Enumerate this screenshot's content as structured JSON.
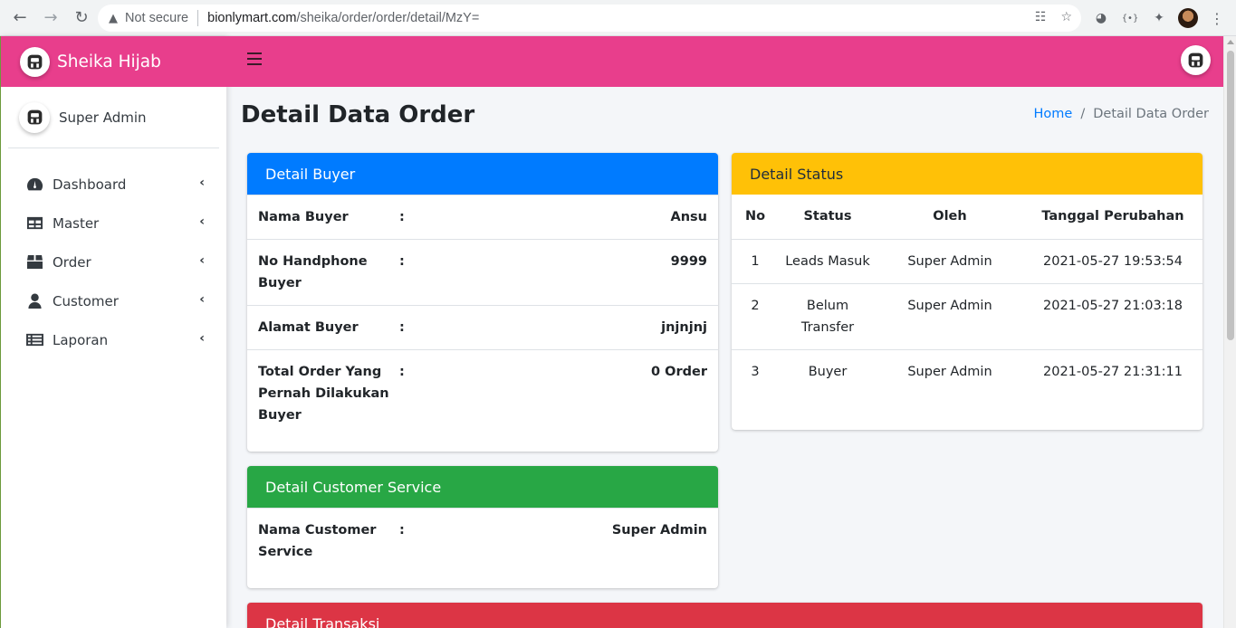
{
  "browser": {
    "security": "Not secure",
    "url_host": "bionlymart.com",
    "url_path": "/sheika/order/order/detail/MzY="
  },
  "brand": {
    "name": "Sheika Hijab"
  },
  "user": {
    "name": "Super Admin"
  },
  "sidebar": {
    "items": [
      {
        "label": "Dashboard",
        "icon": "dashboard-icon"
      },
      {
        "label": "Master",
        "icon": "table-icon"
      },
      {
        "label": "Order",
        "icon": "box-icon"
      },
      {
        "label": "Customer",
        "icon": "user-icon"
      },
      {
        "label": "Laporan",
        "icon": "list-icon"
      }
    ]
  },
  "page": {
    "title": "Detail Data Order",
    "breadcrumb": {
      "home": "Home",
      "current": "Detail Data Order"
    }
  },
  "buyer_card": {
    "title": "Detail Buyer",
    "rows": [
      {
        "key": "Nama Buyer",
        "value": "Ansu"
      },
      {
        "key": "No Handphone Buyer",
        "value": "9999"
      },
      {
        "key": "Alamat Buyer",
        "value": "jnjnjnj"
      },
      {
        "key": "Total Order Yang Pernah Dilakukan Buyer",
        "value": "0 Order"
      }
    ]
  },
  "cs_card": {
    "title": "Detail Customer Service",
    "rows": [
      {
        "key": "Nama Customer Service",
        "value": "Super Admin"
      }
    ]
  },
  "status_card": {
    "title": "Detail Status",
    "columns": [
      "No",
      "Status",
      "Oleh",
      "Tanggal Perubahan"
    ],
    "rows": [
      {
        "no": "1",
        "status": "Leads Masuk",
        "oleh": "Super Admin",
        "tanggal": "2021-05-27 19:53:54"
      },
      {
        "no": "2",
        "status": "Belum Transfer",
        "oleh": "Super Admin",
        "tanggal": "2021-05-27 21:03:18"
      },
      {
        "no": "3",
        "status": "Buyer",
        "oleh": "Super Admin",
        "tanggal": "2021-05-27 21:31:11"
      }
    ]
  },
  "transaksi_card": {
    "title": "Detail Transaksi"
  },
  "colors": {
    "brand_pink": "#e83e8c",
    "primary": "#007bff",
    "success": "#28a745",
    "warning": "#ffc107",
    "danger": "#dc3545"
  }
}
